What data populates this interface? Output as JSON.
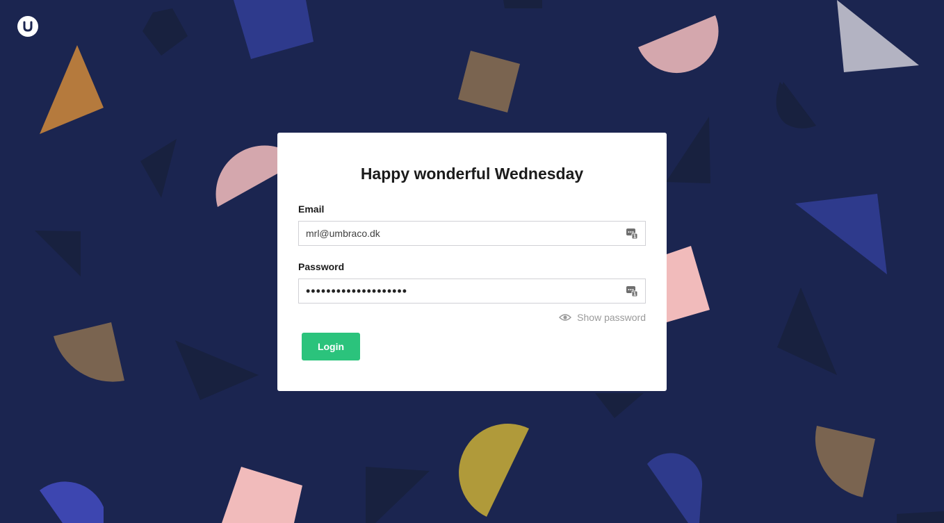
{
  "brand": {
    "logo_icon": "umbraco-logo-icon"
  },
  "background": {
    "base_color": "#1b2550",
    "shape_colors": [
      "#b57a3d",
      "#d4a7ad",
      "#7a6450",
      "#2e3a8c",
      "#b3b3c2",
      "#f1bbbb",
      "#b09a3a",
      "#18213f",
      "#3d46b0"
    ]
  },
  "login": {
    "greeting": "Happy wonderful Wednesday",
    "email_label": "Email",
    "email_value": "mrl@umbraco.dk",
    "password_label": "Password",
    "password_value": "••••••••••••••••••••",
    "show_password_label": "Show password",
    "login_button_label": "Login",
    "accent_color": "#2bc37c"
  }
}
